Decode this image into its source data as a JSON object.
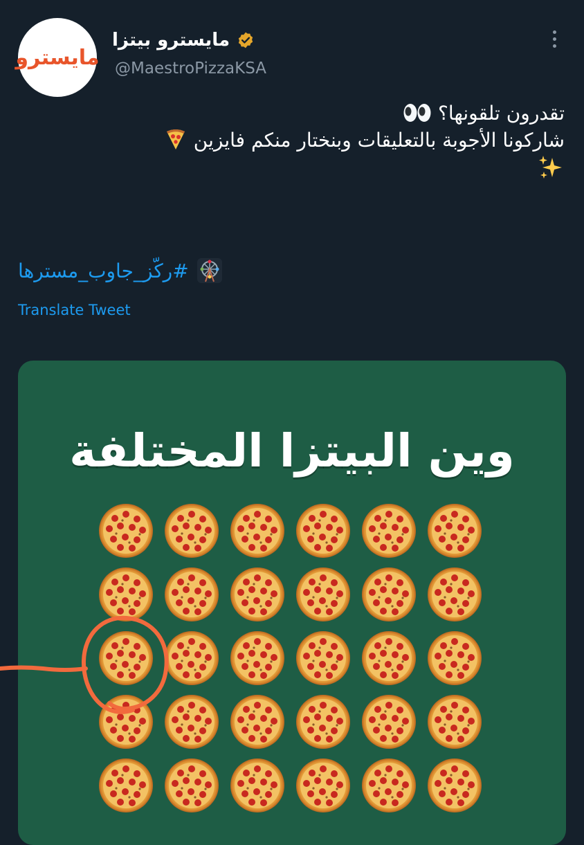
{
  "tweet": {
    "display_name": "مايسترو بيتزا",
    "handle": "@MaestroPizzaKSA",
    "avatar_text": "مايسترو",
    "verified_icon": "verified-badge-icon",
    "more_icon": "more-vertical-icon",
    "body_line1": "تقدرون تلقونها؟",
    "body_line2": "شاركونا الأجوبة بالتعليقات وبنختار منكم فايزين",
    "hashtag": "#ركّز_جاوب_مسترها",
    "translate_label": "Translate Tweet"
  },
  "media": {
    "title": "وين البيتزا المختلفة",
    "background_color": "#1e5d45",
    "grid": {
      "rows": 5,
      "columns": 6
    },
    "annotation": {
      "type": "hand-drawn circle with pointer line",
      "color": "#f26a3d",
      "row": 3,
      "column": 1
    }
  },
  "colors": {
    "background": "#15202b",
    "link": "#1d9bf0",
    "secondary_text": "#8b98a5",
    "verified": "#e5a62b"
  }
}
